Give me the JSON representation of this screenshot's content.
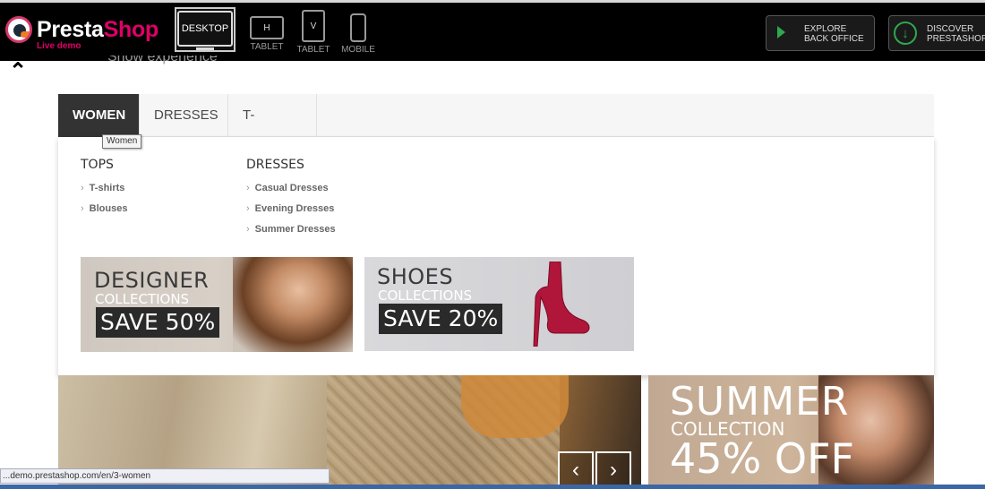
{
  "topbar": {
    "logo": {
      "brand_presta": "Presta",
      "brand_shop": "Shop",
      "subtitle": "Live demo"
    },
    "devices": [
      {
        "name": "desktop",
        "screen": "DESKTOP",
        "label": ""
      },
      {
        "name": "tablet-h",
        "screen": "H",
        "label": "TABLET"
      },
      {
        "name": "tablet-v",
        "screen": "V",
        "label": "TABLET"
      },
      {
        "name": "mobile",
        "screen": "",
        "label": "MOBILE"
      }
    ],
    "explore": {
      "line1": "EXPLORE",
      "line2": "BACK OFFICE"
    },
    "discover": {
      "line1": "DISCOVER",
      "line2": "PRESTASHOP"
    }
  },
  "ghost_text": "Show experience",
  "menu": {
    "items": [
      "WOMEN",
      "DRESSES",
      "T-SHIRTS"
    ],
    "active": "WOMEN",
    "tooltip": "Women"
  },
  "dropdown": {
    "columns": [
      {
        "title": "TOPS",
        "items": [
          "T-shirts",
          "Blouses"
        ]
      },
      {
        "title": "DRESSES",
        "items": [
          "Casual Dresses",
          "Evening Dresses",
          "Summer Dresses"
        ]
      }
    ],
    "chevron": "›",
    "banners": [
      {
        "big": "DESIGNER",
        "mid": "COLLECTIONS",
        "save": "SAVE 50%"
      },
      {
        "big": "SHOES",
        "mid": "COLLECTIONS",
        "save": "SAVE 20%"
      }
    ]
  },
  "slider": {
    "prev": "‹",
    "next": "›"
  },
  "summer": {
    "line1": "SUMMER",
    "line2": "COLLECTION",
    "line3": "45% OFF"
  },
  "statusbar": {
    "url": "...demo.prestashop.com/en/3-women"
  },
  "colors": {
    "brand": "#df0067",
    "accent_green": "#2fa84f",
    "menu_active_bg": "#333333"
  }
}
